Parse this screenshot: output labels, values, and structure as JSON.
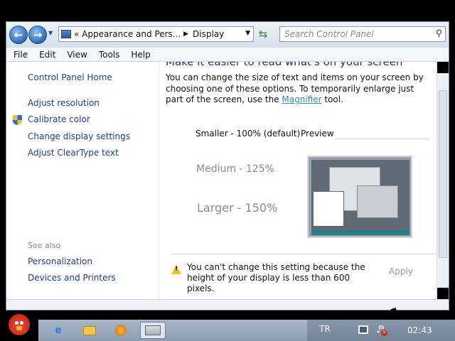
{
  "window": {
    "breadcrumb": [
      "Appearance and Pers...",
      "Display"
    ],
    "search_placeholder": "Search Control Panel",
    "menu": [
      "File",
      "Edit",
      "View",
      "Tools",
      "Help"
    ]
  },
  "left_pane": {
    "home_link": "Control Panel Home",
    "tasks": [
      "Adjust resolution",
      "Calibrate color",
      "Change display settings",
      "Adjust ClearType text"
    ],
    "see_also_label": "See also",
    "see_also_links": [
      "Personalization",
      "Devices and Printers"
    ]
  },
  "main": {
    "title": "Make it easier to read what's on your screen",
    "description_before": "You can change the size of text and items on your screen by choosing one of these options. To temporarily enlarge just part of the screen, use the ",
    "magnifier_link": "Magnifier",
    "description_after": " tool.",
    "options": {
      "smaller": "Smaller - 100% (default)",
      "medium": "Medium - 125%",
      "larger": "Larger - 150%"
    },
    "preview_label": "Preview",
    "warning": "You can't change this setting because the height of your display is less than 600 pixels.",
    "apply_label": "Apply"
  },
  "taskbar": {
    "language": "TR",
    "clock": "02:43",
    "icons": [
      "internet-explorer-icon",
      "windows-explorer-icon",
      "media-player-icon",
      "control-panel-icon"
    ]
  },
  "colors": {
    "link": "#1f3f8f",
    "title": "#1e3287",
    "disabled_text": "#8a8a8a",
    "taskbar": "#9aaabd"
  }
}
